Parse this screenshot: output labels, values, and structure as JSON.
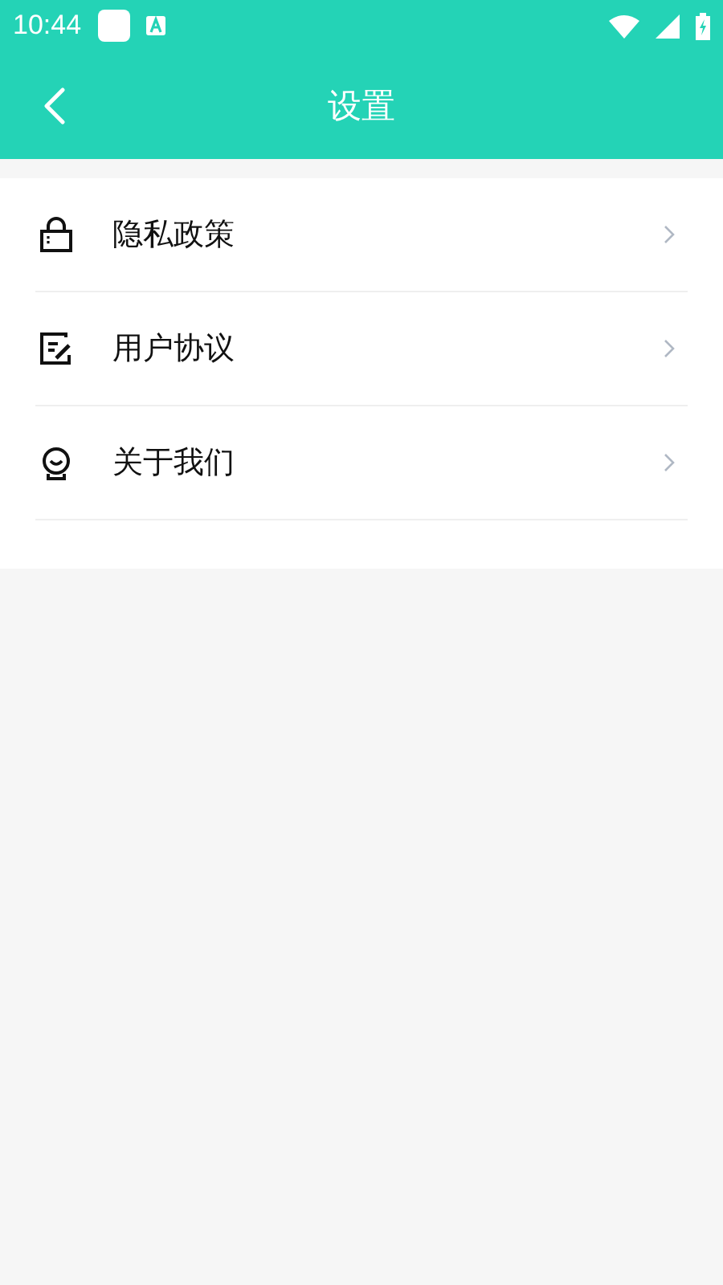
{
  "status_bar": {
    "time": "10:44"
  },
  "header": {
    "title": "设置"
  },
  "menu": [
    {
      "kind": "lock",
      "label": "隐私政策"
    },
    {
      "kind": "document",
      "label": "用户协议"
    },
    {
      "kind": "about",
      "label": "关于我们"
    }
  ]
}
